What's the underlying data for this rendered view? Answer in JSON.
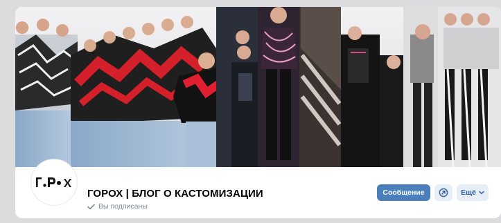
{
  "community": {
    "title": "ГОРОХ | БЛОГ О КАСТОМИЗАЦИИ",
    "logo_text": "ГОРОХ",
    "subscribed_label": "Вы подписаны"
  },
  "actions": {
    "message_label": "Сообщение",
    "share_icon": "share-icon",
    "more_label": "Ещё",
    "more_icon": "chevron-down-icon"
  },
  "cover": {
    "description_icon": "cover-collage"
  },
  "colors": {
    "accent": "#4a7fbb",
    "secondary_button_bg": "#e8eef6",
    "secondary_button_text": "#2d5ea1",
    "muted_text": "#818c99",
    "page_bg": "#dcdcde"
  }
}
